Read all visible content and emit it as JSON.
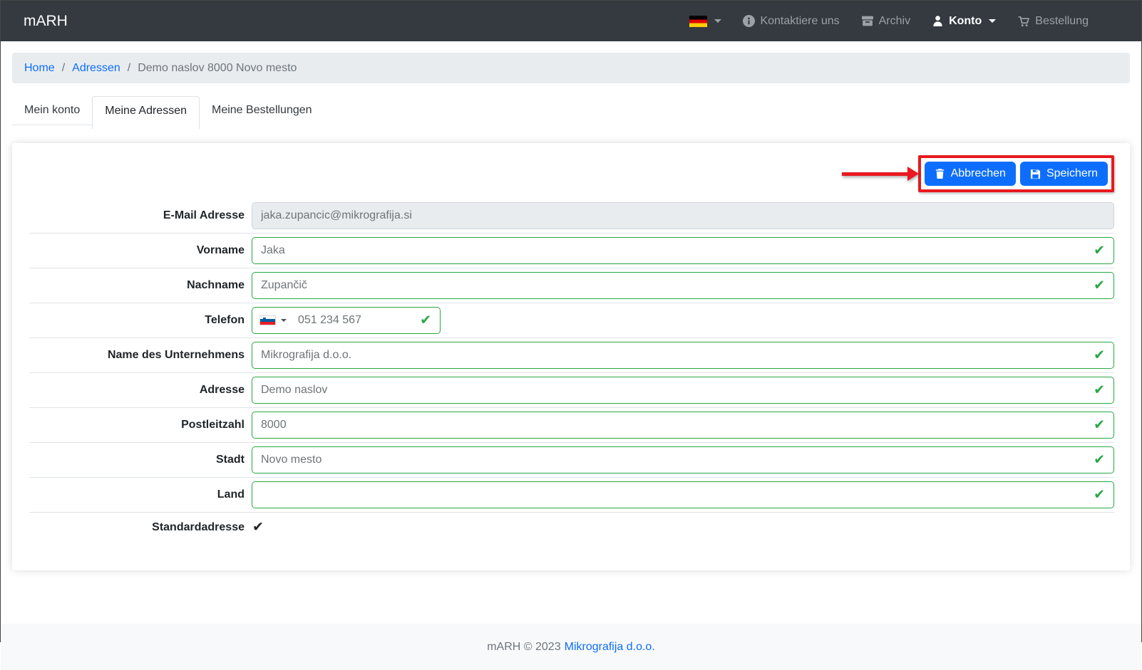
{
  "navbar": {
    "brand": "mARH",
    "language": {
      "flag": "german-flag"
    },
    "items": [
      {
        "label": "Kontaktiere uns",
        "icon": "info-icon",
        "active": false
      },
      {
        "label": "Archiv",
        "icon": "archive-icon",
        "active": false
      },
      {
        "label": "Konto",
        "icon": "person-icon",
        "active": true,
        "has_caret": true
      },
      {
        "label": "Bestellung",
        "icon": "order-icon",
        "active": false
      }
    ]
  },
  "breadcrumb": {
    "items": [
      {
        "label": "Home",
        "link": true
      },
      {
        "label": "Adressen",
        "link": true
      },
      {
        "label": "Demo naslov 8000 Novo mesto",
        "link": false
      }
    ]
  },
  "tabs": [
    {
      "label": "Mein konto",
      "active": false
    },
    {
      "label": "Meine Adressen",
      "active": true
    },
    {
      "label": "Meine Bestellungen",
      "active": false
    }
  ],
  "toolbar": {
    "cancel_label": "Abbrechen",
    "save_label": "Speichern",
    "annotation": "red box and arrow highlighting the action buttons"
  },
  "form": {
    "fields": [
      {
        "label": "E-Mail Adresse",
        "value": "jaka.zupancic@mikrografija.si",
        "state": "disabled"
      },
      {
        "label": "Vorname",
        "value": "Jaka",
        "state": "valid"
      },
      {
        "label": "Nachname",
        "value": "Zupančič",
        "state": "valid"
      },
      {
        "label": "Telefon",
        "value": "051 234 567",
        "state": "valid",
        "country_flag": "slovenia-flag"
      },
      {
        "label": "Name des Unternehmens",
        "value": "Mikrografija d.o.o.",
        "state": "valid"
      },
      {
        "label": "Adresse",
        "value": "Demo naslov",
        "state": "valid"
      },
      {
        "label": "Postleitzahl",
        "value": "8000",
        "state": "valid"
      },
      {
        "label": "Stadt",
        "value": "Novo mesto",
        "state": "valid"
      },
      {
        "label": "Land",
        "value": "",
        "state": "valid"
      }
    ],
    "default_address_label": "Standardadresse",
    "default_address_checked": true
  },
  "icons": {
    "valid_check": "✔",
    "default_check": "✔"
  },
  "footer": {
    "copyright": "mARH © 2023",
    "link_label": "Mikrografija d.o.o."
  },
  "colors": {
    "navbar_bg": "#343a40",
    "primary": "#0d6efd",
    "valid_green": "#28a745",
    "annotation_red": "#e8191f",
    "breadcrumb_bg": "#e9ecef",
    "footer_bg": "#f8f9fa"
  }
}
